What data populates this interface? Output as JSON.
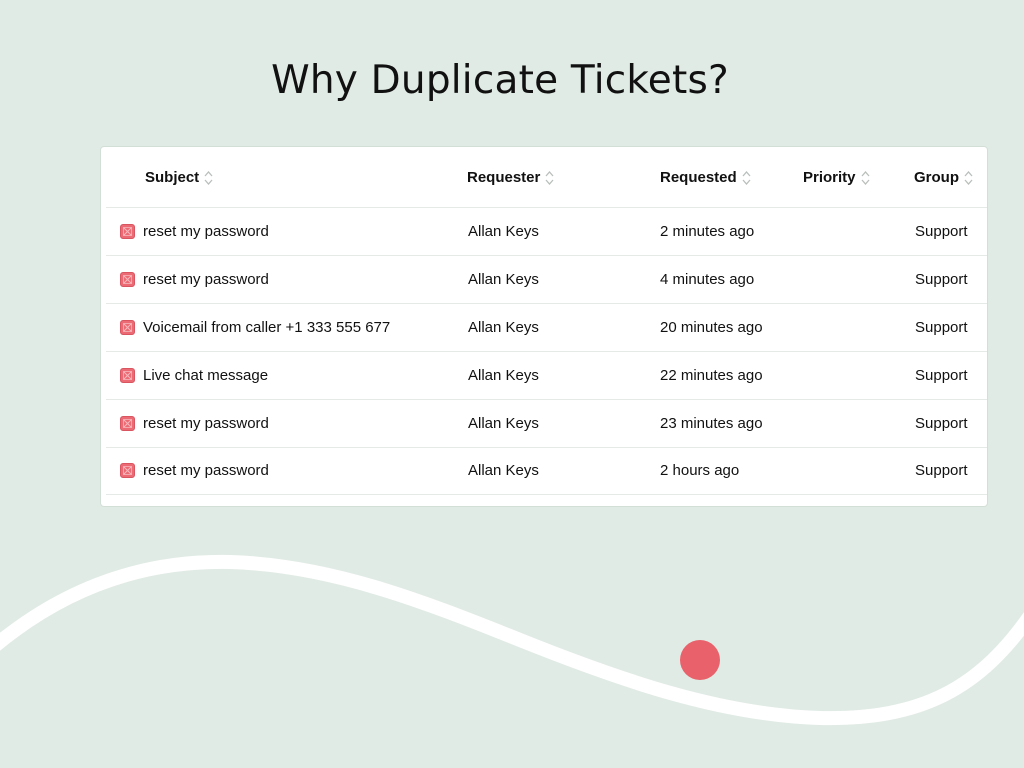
{
  "title": "Why Duplicate Tickets?",
  "colors": {
    "background": "#e1ebe5",
    "accent": "#e8616b",
    "status_icon": "#e8616b"
  },
  "table": {
    "columns": [
      {
        "label": "Subject",
        "icon": "sort-icon"
      },
      {
        "label": "Requester",
        "icon": "sort-icon"
      },
      {
        "label": "Requested",
        "icon": "sort-icon"
      },
      {
        "label": "Priority",
        "icon": "sort-icon"
      },
      {
        "label": "Group",
        "icon": "sort-icon"
      }
    ],
    "rows": [
      {
        "subject": "reset my password",
        "requester": "Allan Keys",
        "requested": "2 minutes ago",
        "priority": "",
        "group": "Support"
      },
      {
        "subject": "reset my password",
        "requester": "Allan Keys",
        "requested": "4 minutes ago",
        "priority": "",
        "group": "Support"
      },
      {
        "subject": "Voicemail from caller +1 333 555 677",
        "requester": "Allan Keys",
        "requested": "20 minutes ago",
        "priority": "",
        "group": "Support"
      },
      {
        "subject": "Live chat message",
        "requester": "Allan Keys",
        "requested": "22 minutes ago",
        "priority": "",
        "group": "Support"
      },
      {
        "subject": "reset my password",
        "requester": "Allan Keys",
        "requested": "23 minutes ago",
        "priority": "",
        "group": "Support"
      },
      {
        "subject": "reset my password",
        "requester": "Allan Keys",
        "requested": "2 hours ago",
        "priority": "",
        "group": "Support"
      }
    ]
  }
}
